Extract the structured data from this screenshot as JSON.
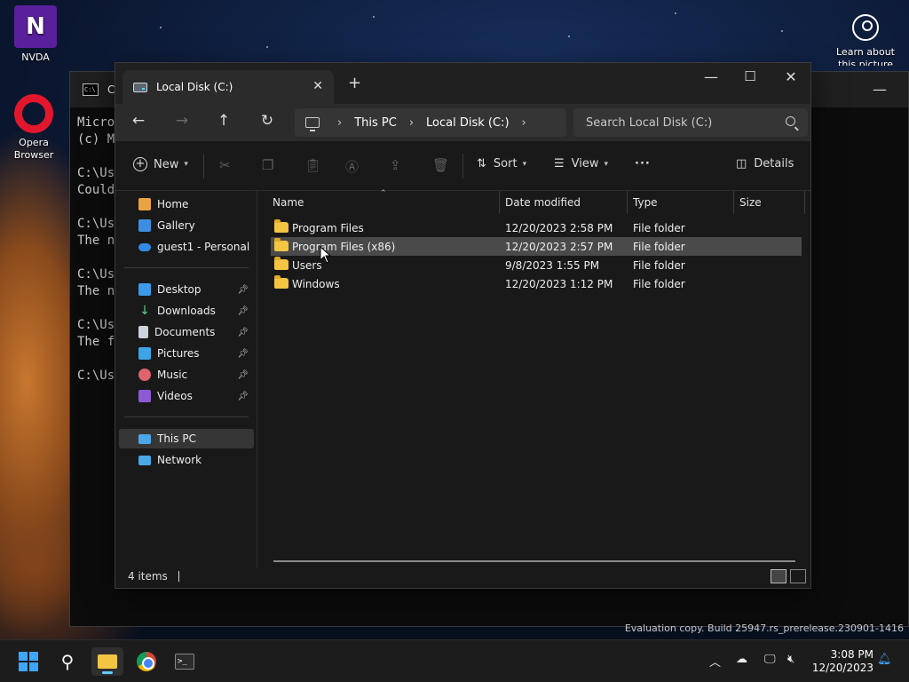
{
  "desktop": {
    "icons": [
      {
        "label": "NVDA"
      },
      {
        "label": "Opera\nBrowser"
      },
      {
        "label": "Learn about this picture"
      }
    ],
    "watermark": "Evaluation copy. Build 25947.rs_prerelease.230901-1416"
  },
  "console": {
    "title": "Co",
    "lines": [
      "Micro",
      "(c) M",
      "",
      "C:\\Us",
      "Could",
      "",
      "C:\\Us",
      "The n",
      "",
      "C:\\Us",
      "The n",
      "",
      "C:\\Us",
      "The f",
      "",
      "C:\\Us"
    ]
  },
  "explorer": {
    "tab_title": "Local Disk (C:)",
    "address": {
      "segments": [
        "This PC",
        "Local Disk (C:)"
      ]
    },
    "search_placeholder": "Search Local Disk (C:)",
    "toolbar": {
      "new": "New",
      "sort": "Sort",
      "view": "View",
      "more": "···",
      "details": "Details"
    },
    "sidebar": {
      "home": "Home",
      "gallery": "Gallery",
      "onedrive": "guest1 - Personal",
      "desktop": "Desktop",
      "downloads": "Downloads",
      "documents": "Documents",
      "pictures": "Pictures",
      "music": "Music",
      "videos": "Videos",
      "this_pc": "This PC",
      "network": "Network"
    },
    "columns": {
      "name": "Name",
      "date": "Date modified",
      "type": "Type",
      "size": "Size"
    },
    "rows": [
      {
        "name": "Program Files",
        "date": "12/20/2023 2:58 PM",
        "type": "File folder"
      },
      {
        "name": "Program Files (x86)",
        "date": "12/20/2023 2:57 PM",
        "type": "File folder"
      },
      {
        "name": "Users",
        "date": "9/8/2023 1:55 PM",
        "type": "File folder"
      },
      {
        "name": "Windows",
        "date": "12/20/2023 1:12 PM",
        "type": "File folder"
      }
    ],
    "selected_row": 1,
    "status": "4 items"
  },
  "taskbar": {
    "clock_time": "3:08 PM",
    "clock_date": "12/20/2023"
  },
  "colors": {
    "accent": "#60cdff",
    "folder": "#f4c542",
    "nvda": "#5a1f9a",
    "opera": "#e2172d"
  }
}
